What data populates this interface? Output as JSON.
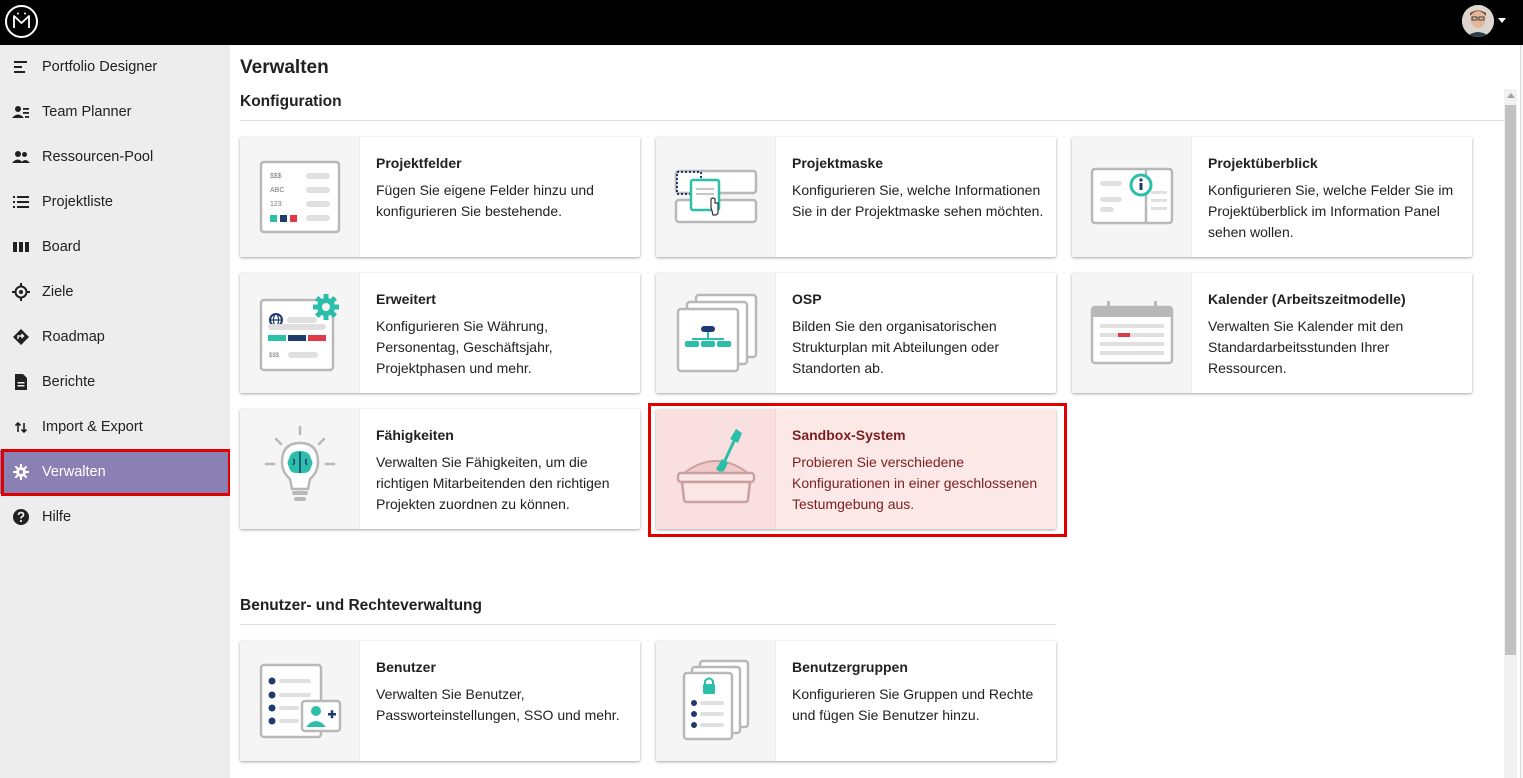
{
  "colors": {
    "accent": "#2bbfa9",
    "navy": "#1e3a6e",
    "red": "#e03a46",
    "active_nav": "#8a80b3",
    "highlight_border": "#e00000"
  },
  "topbar": {
    "logo_icon": "mm-logo-icon",
    "avatar_icon": "user-avatar",
    "caret_icon": "caret-down-icon"
  },
  "sidebar": {
    "items": [
      {
        "label": "Portfolio Designer",
        "icon": "portfolio-designer-icon"
      },
      {
        "label": "Team Planner",
        "icon": "team-planner-icon"
      },
      {
        "label": "Ressourcen-Pool",
        "icon": "people-icon"
      },
      {
        "label": "Projektliste",
        "icon": "list-icon"
      },
      {
        "label": "Board",
        "icon": "board-columns-icon"
      },
      {
        "label": "Ziele",
        "icon": "target-icon"
      },
      {
        "label": "Roadmap",
        "icon": "roadmap-sign-icon"
      },
      {
        "label": "Berichte",
        "icon": "document-icon"
      },
      {
        "label": "Import & Export",
        "icon": "import-export-arrows-icon"
      },
      {
        "label": "Verwalten",
        "icon": "gear-icon",
        "active": true
      },
      {
        "label": "Hilfe",
        "icon": "help-icon"
      }
    ]
  },
  "main": {
    "title": "Verwalten",
    "sections": [
      {
        "title": "Konfiguration",
        "cards": [
          {
            "title": "Projektfelder",
            "desc": "Fügen Sie eigene Felder hinzu und konfigurieren Sie bestehende.",
            "icon": "project-fields-icon",
            "icon_text": [
              "$$$",
              "ABC",
              "123"
            ]
          },
          {
            "title": "Projektmaske",
            "desc": "Konfigurieren Sie, welche Informationen Sie in der Projektmaske sehen möchten.",
            "icon": "project-mask-icon"
          },
          {
            "title": "Projektüberblick",
            "desc": "Konfigurieren Sie, welche Felder Sie im Projektüberblick im Information Panel sehen wollen.",
            "icon": "project-overview-icon"
          },
          {
            "title": "Erweitert",
            "desc": "Konfigurieren Sie Währung, Personentag, Geschäftsjahr, Projektphasen und mehr.",
            "icon": "advanced-settings-icon",
            "icon_text": [
              "$$$"
            ]
          },
          {
            "title": "OSP",
            "desc": "Bilden Sie den organisatorischen Strukturplan mit Abteilungen oder Standorten ab.",
            "icon": "org-chart-icon"
          },
          {
            "title": "Kalender (Arbeitszeitmodelle)",
            "desc": "Verwalten Sie Kalender mit den Standardarbeitsstunden Ihrer Ressourcen.",
            "icon": "calendar-icon"
          },
          {
            "title": "Fähigkeiten",
            "desc": "Verwalten Sie Fähigkeiten, um die richtigen Mitarbeitenden den richtigen Projekten zuordnen zu können.",
            "icon": "skills-lightbulb-icon"
          },
          {
            "title": "Sandbox-System",
            "desc": "Probieren Sie verschiedene Konfigurationen in einer geschlossenen Testumgebung aus.",
            "icon": "sandbox-shovel-icon",
            "highlighted": true
          }
        ]
      },
      {
        "title": "Benutzer- und Rechteverwaltung",
        "cards": [
          {
            "title": "Benutzer",
            "desc": "Verwalten Sie Benutzer, Passworteinstellungen, SSO und mehr.",
            "icon": "user-add-icon"
          },
          {
            "title": "Benutzergruppen",
            "desc": "Konfigurieren Sie Gruppen und Rechte und fügen Sie Benutzer hinzu.",
            "icon": "user-groups-lock-icon"
          }
        ]
      }
    ]
  }
}
